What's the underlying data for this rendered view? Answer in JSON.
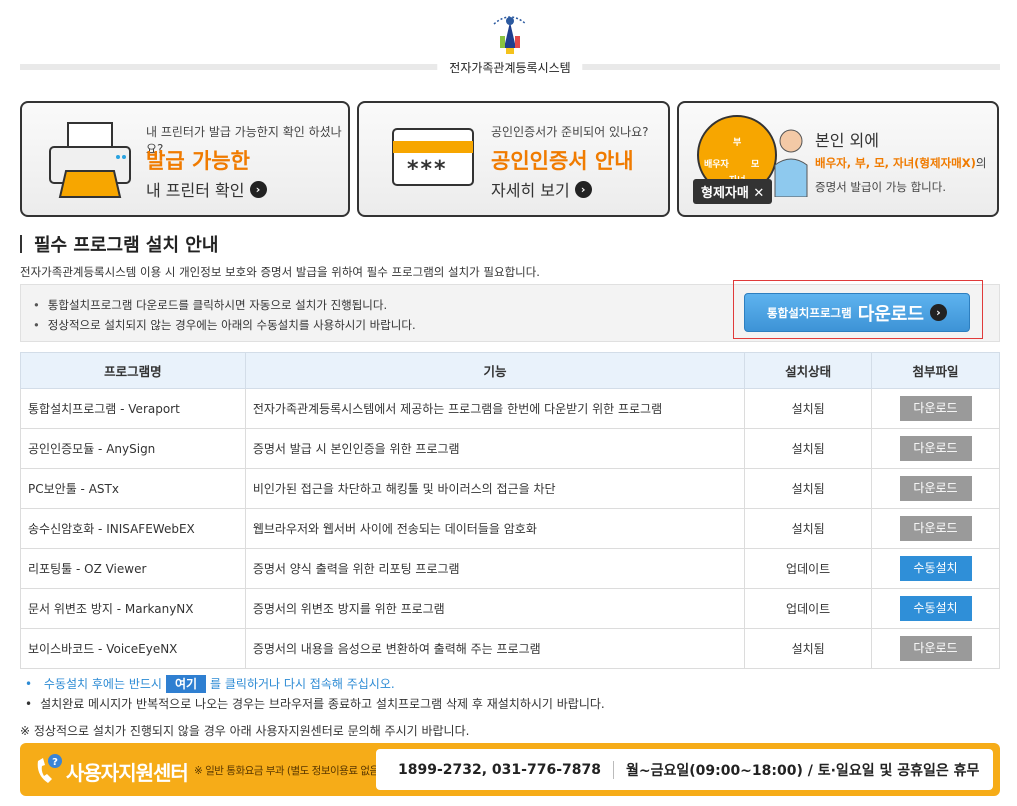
{
  "header": {
    "system_name": "전자가족관계등록시스템"
  },
  "banners": [
    {
      "small": "내 프린터가 발급 가능한지 확인 하셨나요?",
      "big": "발급 가능한",
      "link": "내 프린터 확인"
    },
    {
      "small": "공인인증서가 준비되어 있나요?",
      "big": "공인인증서 안내",
      "link": "자세히 보기",
      "cert_text": "***"
    },
    {
      "heading": "본인 외에",
      "highlight": "배우자, 부, 모, 자녀(형제자매X)",
      "suffix": "의",
      "line2": "증명서 발급이 가능 합니다.",
      "badge": "형제자매 ✕",
      "circle_labels": [
        "배우자",
        "부",
        "모",
        "자녀"
      ]
    }
  ],
  "section": {
    "title": "필수 프로그램 설치 안내",
    "desc": "전자가족관계등록시스템 이용 시 개인정보 보호와 증명서 발급을 위하여 필수 프로그램의 설치가 필요합니다."
  },
  "notice": {
    "items": [
      "통합설치프로그램 다운로드를 클릭하시면 자동으로 설치가 진행됩니다.",
      "정상적으로 설치되지 않는 경우에는 아래의 수동설치를 사용하시기 바랍니다."
    ],
    "button_small": "통합설치프로그램",
    "button_large": "다운로드"
  },
  "table": {
    "headers": [
      "프로그램명",
      "기능",
      "설치상태",
      "첨부파일"
    ],
    "rows": [
      {
        "name": "통합설치프로그램 - Veraport",
        "func": "전자가족관계등록시스템에서 제공하는 프로그램을 한번에 다운받기 위한 프로그램",
        "status": "설치됨",
        "action": "다운로드",
        "style": "gray"
      },
      {
        "name": "공인인증모듈 - AnySign",
        "func": "증명서 발급 시 본인인증을 위한 프로그램",
        "status": "설치됨",
        "action": "다운로드",
        "style": "gray"
      },
      {
        "name": "PC보안툴 - ASTx",
        "func": "비인가된 접근을 차단하고 해킹툴 및 바이러스의 접근을 차단",
        "status": "설치됨",
        "action": "다운로드",
        "style": "gray"
      },
      {
        "name": "송수신암호화 - INISAFEWebEX",
        "func": "웹브라우저와 웹서버 사이에 전송되는 데이터들을 암호화",
        "status": "설치됨",
        "action": "다운로드",
        "style": "gray"
      },
      {
        "name": "리포팅툴 - OZ Viewer",
        "func": "증명서 양식 출력을 위한 리포팅 프로그램",
        "status": "업데이트",
        "action": "수동설치",
        "style": "blue"
      },
      {
        "name": "문서 위변조 방지 - MarkanyNX",
        "func": "증명서의 위변조 방지를 위한 프로그램",
        "status": "업데이트",
        "action": "수동설치",
        "style": "blue"
      },
      {
        "name": "보이스바코드 - VoiceEyeNX",
        "func": "증명서의 내용을 음성으로 변환하여 출력해 주는 프로그램",
        "status": "설치됨",
        "action": "다운로드",
        "style": "gray"
      }
    ]
  },
  "notes": {
    "line1_pre": "수동설치 후에는 반드시",
    "here": "여기",
    "line1_post": "를 클릭하거나 다시 접속해 주십시오.",
    "line2": "설치완료 메시지가 반복적으로 나오는 경우는 브라우저를 종료하고 설치프로그램 삭제 후 재설치하시기 바랍니다.",
    "warn": "※ 정상적으로 설치가 진행되지 않을 경우 아래 사용자지원센터로 문의해 주시기 바랍니다."
  },
  "support": {
    "title": "사용자지원센터",
    "sub": "※ 일반 통화요금 부과 (별도 정보이용료 없음)",
    "phone": "1899-2732, 031-776-7878",
    "hours": "월~금요일(09:00~18:00) / 토·일요일 및 공휴일은 휴무"
  },
  "colors": {
    "accent_orange": "#f07b00",
    "support_bg": "#f6ac18",
    "button_blue": "#3d93d6",
    "button_gray": "#9a9a9a"
  }
}
